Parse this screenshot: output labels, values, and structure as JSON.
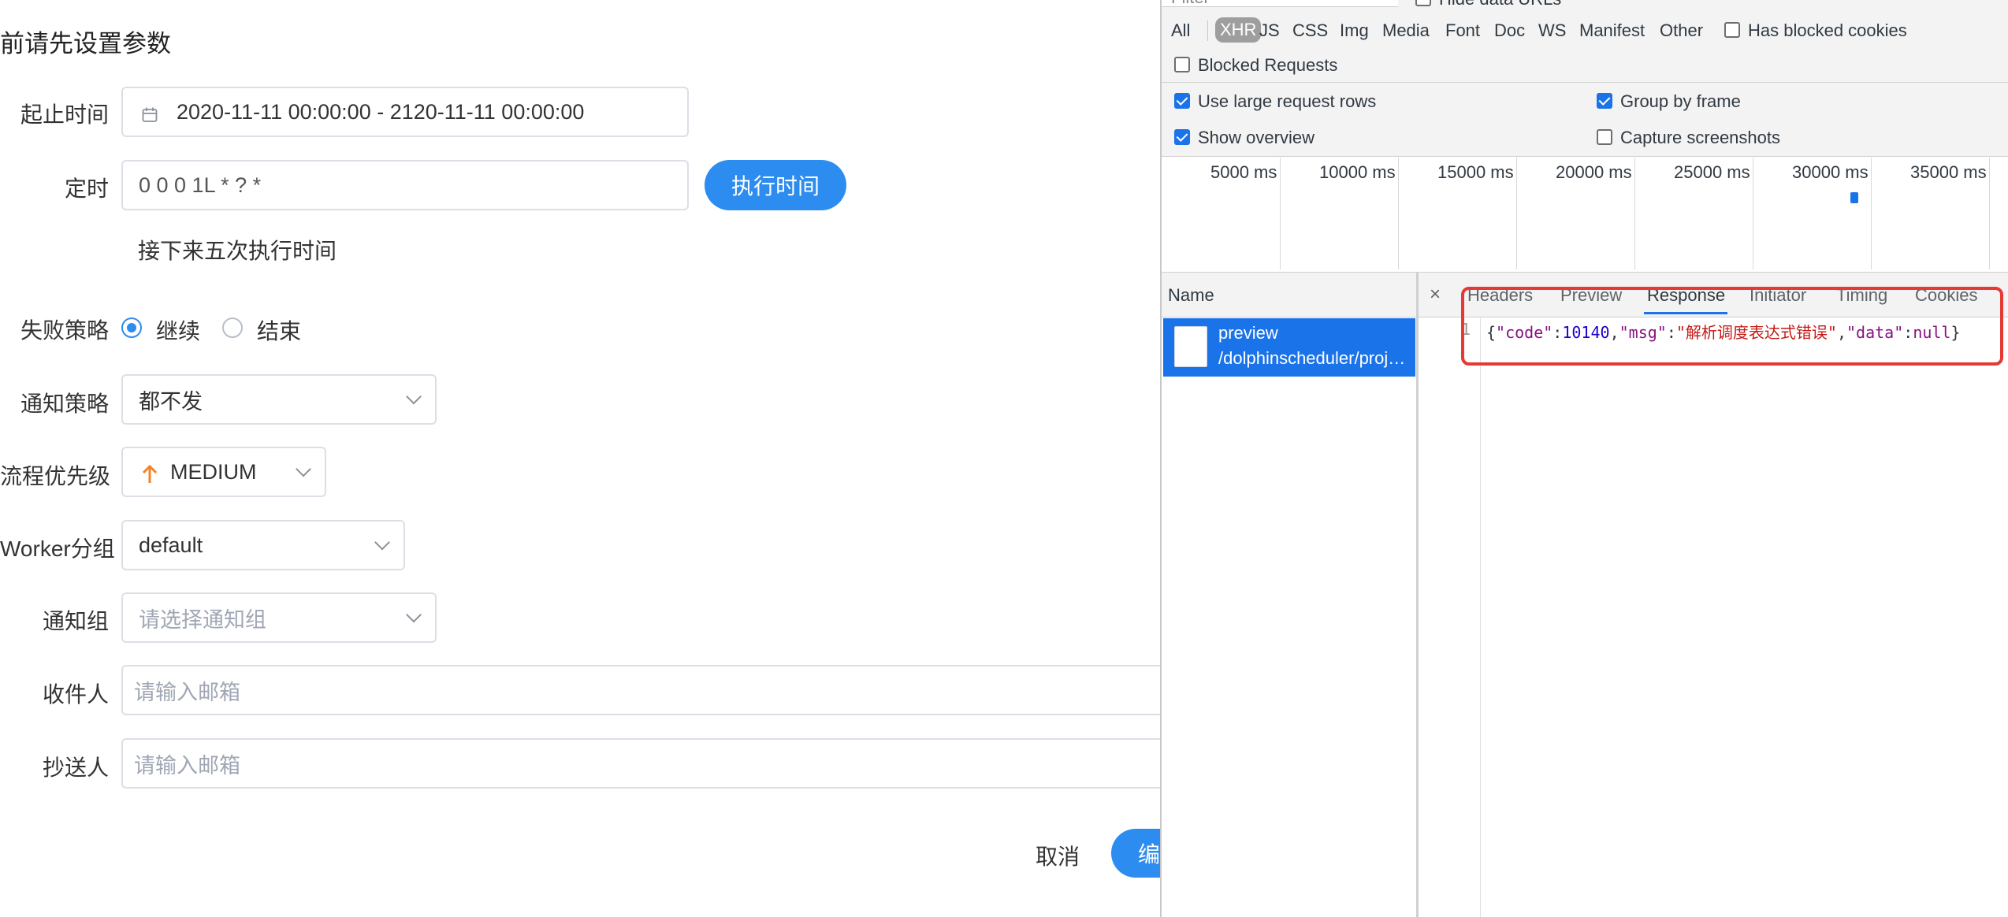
{
  "form": {
    "title": "前请先设置参数",
    "start_end": {
      "label": "起止时间",
      "value": "2020-11-11 00:00:00 - 2120-11-11 00:00:00"
    },
    "timing": {
      "label": "定时",
      "value": "0 0 0 1L * ? *",
      "button": "执行时间"
    },
    "next_five_label": "接下来五次执行时间",
    "failure": {
      "label": "失败策略",
      "options": [
        "继续",
        "结束"
      ],
      "selected": "继续"
    },
    "notify": {
      "label": "通知策略",
      "value": "都不发"
    },
    "priority": {
      "label": "流程优先级",
      "value": "MEDIUM",
      "arrow_color": "#f5822a"
    },
    "worker": {
      "label": "Worker分组",
      "value": "default"
    },
    "notify_group": {
      "label": "通知组",
      "placeholder": "请选择通知组"
    },
    "recipient": {
      "label": "收件人",
      "placeholder": "请输入邮箱"
    },
    "cc": {
      "label": "抄送人",
      "placeholder": "请输入邮箱"
    },
    "cancel": "取消",
    "submit_partial": "编"
  },
  "devtools": {
    "filter_placeholder": "Filter",
    "hide_data_urls": "Hide data URLs",
    "types": [
      "All",
      "XHR",
      "JS",
      "CSS",
      "Img",
      "Media",
      "Font",
      "Doc",
      "WS",
      "Manifest",
      "Other"
    ],
    "active_type": "XHR",
    "has_blocked_cookies": "Has blocked cookies",
    "blocked_requests": "Blocked Requests",
    "use_large_rows": "Use large request rows",
    "group_by_frame": "Group by frame",
    "show_overview": "Show overview",
    "capture_screenshots": "Capture screenshots",
    "timeline_ticks": [
      "5000 ms",
      "10000 ms",
      "15000 ms",
      "20000 ms",
      "25000 ms",
      "30000 ms",
      "35000 ms"
    ],
    "name_header": "Name",
    "request": {
      "name": "preview",
      "path": "/dolphinscheduler/proj…"
    },
    "close_symbol": "×",
    "tabs": [
      "Headers",
      "Preview",
      "Response",
      "Initiator",
      "Timing",
      "Cookies"
    ],
    "active_tab": "Response",
    "response_line_number": "1",
    "response": {
      "p1": "{",
      "k1": "\"code\"",
      "c1": ":",
      "v1": "10140",
      "s1": ",",
      "k2": "\"msg\"",
      "c2": ":",
      "v2": "\"解析调度表达式错误\"",
      "s2": ",",
      "k3": "\"data\"",
      "c3": ":",
      "v3": "null",
      "p2": "}"
    },
    "highlight_color": "#e53935",
    "accent_color": "#1a73e8"
  }
}
